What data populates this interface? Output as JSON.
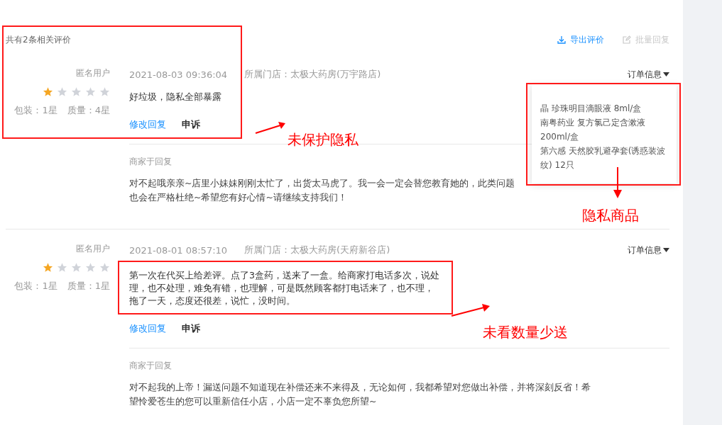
{
  "header": {
    "total": "共有2条相关评价",
    "actions": [
      {
        "label": "导出评价",
        "kind": "export",
        "disabled": false
      },
      {
        "label": "批量回复",
        "kind": "batch_reply",
        "disabled": true
      }
    ]
  },
  "reviews": [
    {
      "user": "匿名用户",
      "stars": 1,
      "scores": [
        "包装：1星",
        "质量：4星"
      ],
      "time": "2021-08-03 09:36:04",
      "store": "所属门店：太极大药房(万宇路店)",
      "comment": "好垃圾，隐私全部暴露",
      "actions": [
        {
          "label": "修改回复",
          "kind": "link"
        },
        {
          "label": "申诉",
          "kind": "strong"
        }
      ],
      "order_info": "订单信息",
      "order_items": [
        "晶 珍珠明目滴眼液 8ml/盒",
        "南粤药业 复方氯己定含漱液 200ml/盒",
        "第六感 天然胶乳避孕套(诱惑装波纹) 12只"
      ],
      "reply_label": "商家于回复",
      "reply": "对不起哦亲亲~店里小妹妹刚刚太忙了，出货太马虎了。我一会一定会替您教育她的，此类问题也会在严格杜绝~希望您有好心情~请继续支持我们！"
    },
    {
      "user": "匿名用户",
      "stars": 1,
      "scores": [
        "包装：1星",
        "质量：1星"
      ],
      "time": "2021-08-01 08:57:10",
      "store": "所属门店：太极大药房(天府新谷店)",
      "comment": "第一次在代买上给差评。点了3盒药，送来了一盒。给商家打电话多次，说处理，也不处理，难免有错，也理解，可是既然顾客都打电话来了，也不理，拖了一天，态度还很差，说忙，没时间。",
      "actions": [
        {
          "label": "修改回复",
          "kind": "link"
        },
        {
          "label": "申诉",
          "kind": "strong"
        }
      ],
      "order_info": "订单信息",
      "reply_label": "商家于回复",
      "reply": "对不起我的上帝！漏送问题不知道现在补偿还来不来得及，无论如何，我都希望对您做出补偿，并将深刻反省！希望怜爱苍生的您可以重新信任小店，小店一定不辜负您所望~"
    }
  ],
  "annotations": [
    {
      "text": "未保护隐私"
    },
    {
      "text": "隐私商品"
    },
    {
      "text": "未看数量少送"
    }
  ]
}
